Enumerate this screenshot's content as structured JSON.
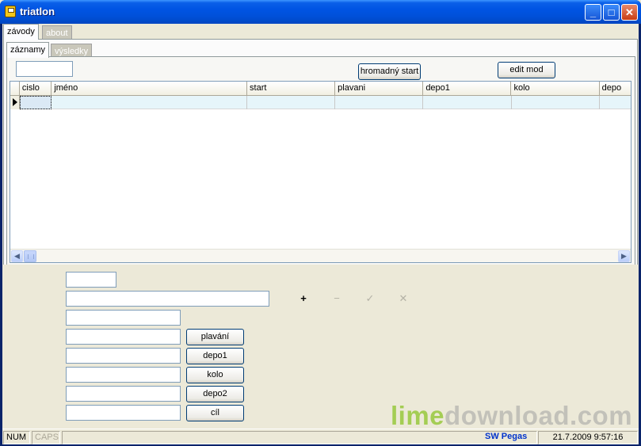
{
  "window": {
    "title": "triatlon"
  },
  "outer_tabs": [
    {
      "label": "závody",
      "active": true
    },
    {
      "label": "about",
      "active": false
    }
  ],
  "inner_tabs": [
    {
      "label": "záznamy",
      "active": true
    },
    {
      "label": "výsledky",
      "active": false
    }
  ],
  "toolbar": {
    "filter_value": "",
    "mass_start_label": "hromadný start",
    "edit_mode_label": "edit mod"
  },
  "grid": {
    "columns": [
      "cislo",
      "jméno",
      "start",
      "plavani",
      "depo1",
      "kolo",
      "depo"
    ],
    "rows": [
      [
        "",
        "",
        "",
        "",
        "",
        "",
        ""
      ]
    ]
  },
  "form": {
    "number_value": "",
    "name_value": "",
    "start_value": "",
    "swim_value": "",
    "depo1_value": "",
    "bike_value": "",
    "depo2_value": "",
    "finish_value": "",
    "buttons": {
      "swim": "plavání",
      "depo1": "depo1",
      "bike": "kolo",
      "depo2": "depo2",
      "finish": "cíl"
    },
    "nav_icons": {
      "add": "+",
      "remove": "−",
      "confirm": "✓",
      "cancel": "✕"
    }
  },
  "watermark": {
    "part1": "lime",
    "part2": "download.com"
  },
  "statusbar": {
    "num": "NUM",
    "caps": "CAPS",
    "brand": "SW Pegas",
    "datetime": "21.7.2009 9:57:16"
  },
  "colors": {
    "titlebar": "#0054e3",
    "selected_row": "#e6f5fa",
    "brand": "#0033cc"
  }
}
